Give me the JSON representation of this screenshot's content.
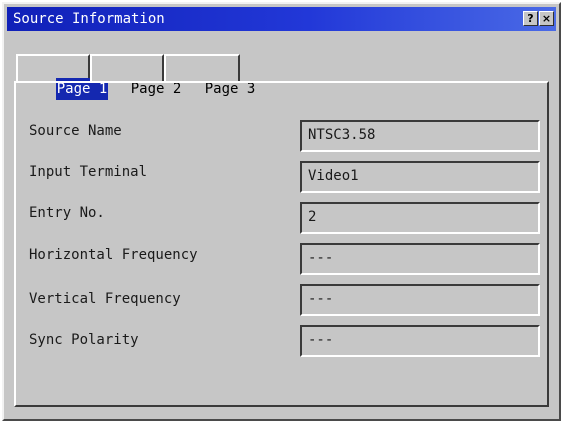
{
  "window": {
    "title": "Source Information",
    "help_button": "?",
    "close_button": "×"
  },
  "tabs": [
    {
      "label": "Page 1",
      "active": true
    },
    {
      "label": "Page 2",
      "active": false
    },
    {
      "label": "Page 3",
      "active": false
    }
  ],
  "fields": [
    {
      "label": "Source Name",
      "value": "NTSC3.58"
    },
    {
      "label": "Input Terminal",
      "value": "Video1"
    },
    {
      "label": "Entry No.",
      "value": "2"
    },
    {
      "label": "Horizontal Frequency",
      "value": "---"
    },
    {
      "label": "Vertical Frequency",
      "value": "---"
    },
    {
      "label": "Sync Polarity",
      "value": "---"
    }
  ],
  "colors": {
    "titlebar": "#1020b8",
    "window_bg": "#c6c6c6",
    "active_tab_highlight": "#1428b0"
  }
}
